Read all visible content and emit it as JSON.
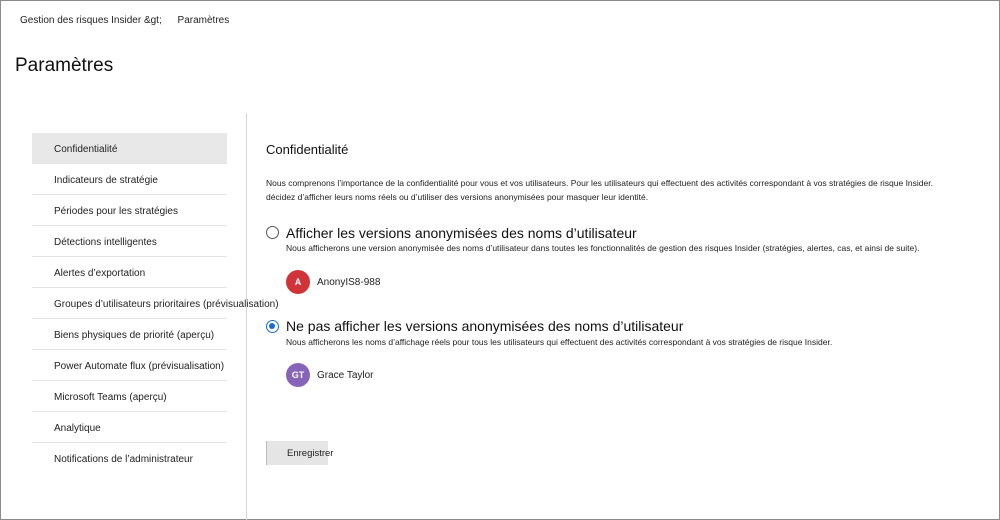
{
  "breadcrumb": {
    "parent": "Gestion des risques Insider &gt;",
    "current": "Paramètres"
  },
  "page_title": "Paramètres",
  "sidebar": {
    "items": [
      {
        "label": "Confidentialité",
        "active": true
      },
      {
        "label": "Indicateurs de stratégie"
      },
      {
        "label": "Périodes pour les stratégies"
      },
      {
        "label": "Détections intelligentes"
      },
      {
        "label": "Alertes d’exportation"
      },
      {
        "label": "Groupes d’utilisateurs prioritaires (prévisualisation)"
      },
      {
        "label": "Biens physiques de priorité (aperçu)"
      },
      {
        "label": "Power Automate flux (prévisualisation)"
      },
      {
        "label": "Microsoft Teams (aperçu)"
      },
      {
        "label": "Analytique"
      },
      {
        "label": "Notifications de l’administrateur"
      }
    ]
  },
  "privacy": {
    "title": "Confidentialité",
    "intro_line1": "Nous comprenons l’importance de la confidentialité pour vous et vos utilisateurs. Pour les utilisateurs qui effectuent des activités correspondant à vos stratégies de risque Insider.",
    "intro_line2": "décidez d’afficher leurs noms réels ou d’utiliser des versions anonymisées pour masquer leur identité.",
    "option_anonymized": {
      "title": "Afficher les versions anonymisées des noms d’utilisateur",
      "description": "Nous afficherons une version anonymisée des noms d’utilisateur dans toutes les fonctionnalités de gestion des risques Insider (stratégies, alertes, cas, et ainsi de suite).",
      "avatar_initials": "A",
      "avatar_color": "#d13438",
      "example_name": "AnonyIS8-988",
      "selected": false
    },
    "option_real": {
      "title": "Ne pas afficher les versions anonymisées des noms d’utilisateur",
      "description": "Nous afficherons les noms d’affichage réels pour tous les utilisateurs qui effectuent des activités correspondant à vos stratégies de risque Insider.",
      "avatar_initials": "GT",
      "avatar_color": "#8764b8",
      "example_name": "Grace Taylor",
      "selected": true
    },
    "save_label": "Enregistrer"
  },
  "colors": {
    "accent": "#1a6bd1",
    "active_nav_bg": "#e8e8e8"
  }
}
